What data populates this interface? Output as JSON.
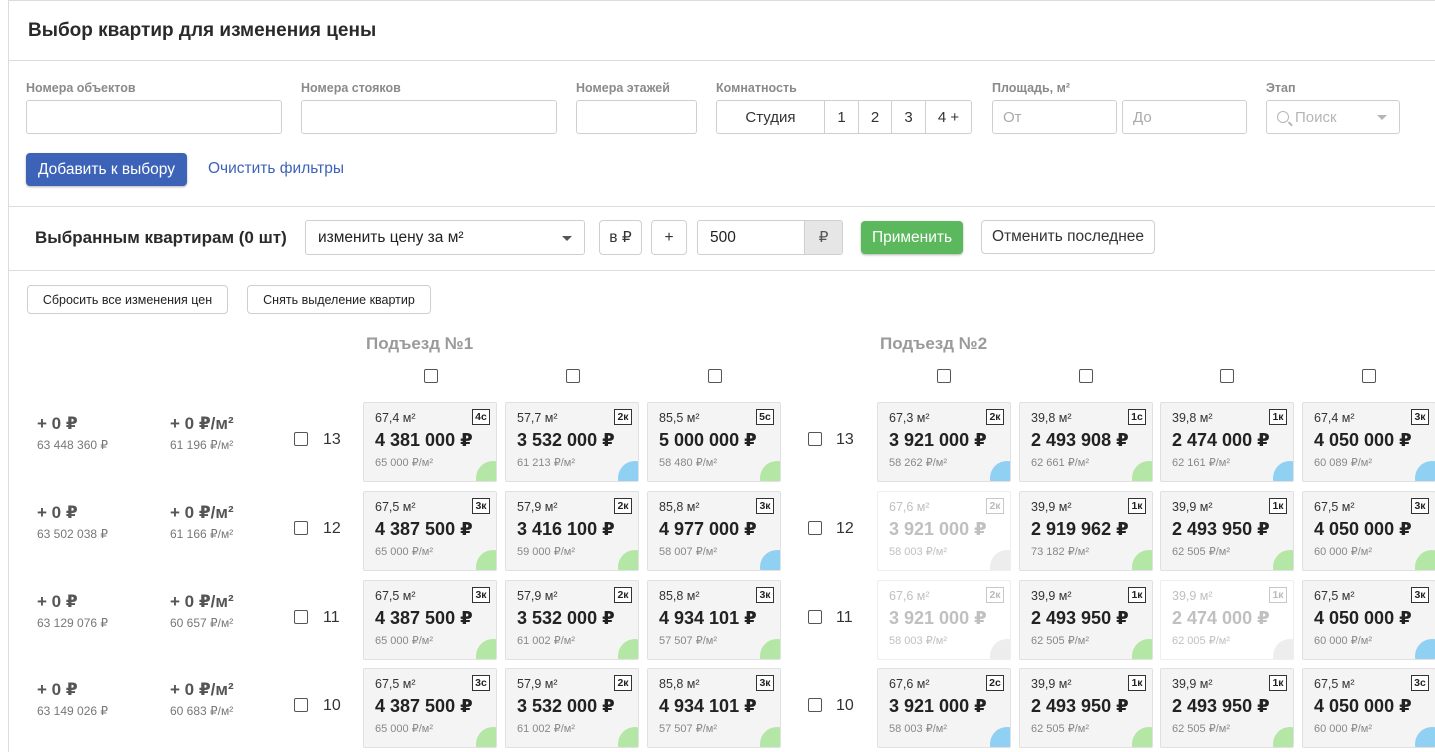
{
  "page_title": "Выбор квартир для изменения цены",
  "filters": {
    "objects_label": "Номера объектов",
    "risers_label": "Номера стояков",
    "floors_label": "Номера этажей",
    "rooms_label": "Комнатность",
    "rooms_options": [
      "Студия",
      "1",
      "2",
      "3",
      "4 +"
    ],
    "area_label": "Площадь, м²",
    "area_from_placeholder": "От",
    "area_to_placeholder": "До",
    "stage_label": "Этап",
    "stage_placeholder": "Поиск",
    "add_button": "Добавить к выбору",
    "clear_link": "Очистить фильтры"
  },
  "action_bar": {
    "selected_label": "Выбранным квартирам (0 шт)",
    "mode_value": "изменить цену за м²",
    "unit_toggle": "в ₽",
    "sign": "+",
    "amount_value": "500",
    "amount_unit": "₽",
    "apply_button": "Применить",
    "undo_button": "Отменить последнее"
  },
  "reset_buttons": {
    "reset_prices": "Сбросить все изменения цен",
    "clear_selection": "Снять выделение квартир"
  },
  "entrances": [
    "Подъезд №1",
    "Подъезд №2"
  ],
  "floors": [
    {
      "floor": "13",
      "delta_total": "+ 0 ₽",
      "total": "63 448 360 ₽",
      "delta_ppm": "+ 0 ₽/м²",
      "avg_ppm": "61 196 ₽/м²",
      "entrance1": [
        {
          "area": "67,4 м²",
          "type": "4с",
          "price": "4 381 000 ₽",
          "ppm": "65 000 ₽/м²",
          "status": "green",
          "dim": false
        },
        {
          "area": "57,7 м²",
          "type": "2к",
          "price": "3 532 000 ₽",
          "ppm": "61 213 ₽/м²",
          "status": "blue",
          "dim": false
        },
        {
          "area": "85,5 м²",
          "type": "5с",
          "price": "5 000 000 ₽",
          "ppm": "58 480 ₽/м²",
          "status": "green",
          "dim": false
        }
      ],
      "entrance2": [
        {
          "area": "67,3 м²",
          "type": "2к",
          "price": "3 921 000 ₽",
          "ppm": "58 262 ₽/м²",
          "status": "blue",
          "dim": false
        },
        {
          "area": "39,8 м²",
          "type": "1с",
          "price": "2 493 908 ₽",
          "ppm": "62 661 ₽/м²",
          "status": "green",
          "dim": false
        },
        {
          "area": "39,8 м²",
          "type": "1к",
          "price": "2 474 000 ₽",
          "ppm": "62 161 ₽/м²",
          "status": "blue",
          "dim": false
        },
        {
          "area": "67,4 м²",
          "type": "3к",
          "price": "4 050 000 ₽",
          "ppm": "60 089 ₽/м²",
          "status": "blue",
          "dim": false
        }
      ]
    },
    {
      "floor": "12",
      "delta_total": "+ 0 ₽",
      "total": "63 502 038 ₽",
      "delta_ppm": "+ 0 ₽/м²",
      "avg_ppm": "61 166 ₽/м²",
      "entrance1": [
        {
          "area": "67,5 м²",
          "type": "3к",
          "price": "4 387 500 ₽",
          "ppm": "65 000 ₽/м²",
          "status": "green",
          "dim": false
        },
        {
          "area": "57,9 м²",
          "type": "2к",
          "price": "3 416 100 ₽",
          "ppm": "59 000 ₽/м²",
          "status": "green",
          "dim": false
        },
        {
          "area": "85,8 м²",
          "type": "3к",
          "price": "4 977 000 ₽",
          "ppm": "58 007 ₽/м²",
          "status": "blue",
          "dim": false
        }
      ],
      "entrance2": [
        {
          "area": "67,6 м²",
          "type": "2к",
          "price": "3 921 000 ₽",
          "ppm": "58 003 ₽/м²",
          "status": "grey",
          "dim": true
        },
        {
          "area": "39,9 м²",
          "type": "1к",
          "price": "2 919 962 ₽",
          "ppm": "73 182 ₽/м²",
          "status": "green",
          "dim": false
        },
        {
          "area": "39,9 м²",
          "type": "1к",
          "price": "2 493 950 ₽",
          "ppm": "62 505 ₽/м²",
          "status": "green",
          "dim": false
        },
        {
          "area": "67,5 м²",
          "type": "3к",
          "price": "4 050 000 ₽",
          "ppm": "60 000 ₽/м²",
          "status": "green",
          "dim": false
        }
      ]
    },
    {
      "floor": "11",
      "delta_total": "+ 0 ₽",
      "total": "63 129 076 ₽",
      "delta_ppm": "+ 0 ₽/м²",
      "avg_ppm": "60 657 ₽/м²",
      "entrance1": [
        {
          "area": "67,5 м²",
          "type": "3к",
          "price": "4 387 500 ₽",
          "ppm": "65 000 ₽/м²",
          "status": "green",
          "dim": false
        },
        {
          "area": "57,9 м²",
          "type": "2к",
          "price": "3 532 000 ₽",
          "ppm": "61 002 ₽/м²",
          "status": "green",
          "dim": false
        },
        {
          "area": "85,8 м²",
          "type": "3к",
          "price": "4 934 101 ₽",
          "ppm": "57 507 ₽/м²",
          "status": "green",
          "dim": false
        }
      ],
      "entrance2": [
        {
          "area": "67,6 м²",
          "type": "2к",
          "price": "3 921 000 ₽",
          "ppm": "58 003 ₽/м²",
          "status": "grey",
          "dim": true
        },
        {
          "area": "39,9 м²",
          "type": "1к",
          "price": "2 493 950 ₽",
          "ppm": "62 505 ₽/м²",
          "status": "green",
          "dim": false
        },
        {
          "area": "39,9 м²",
          "type": "1к",
          "price": "2 474 000 ₽",
          "ppm": "62 005 ₽/м²",
          "status": "grey",
          "dim": true
        },
        {
          "area": "67,5 м²",
          "type": "3к",
          "price": "4 050 000 ₽",
          "ppm": "60 000 ₽/м²",
          "status": "blue",
          "dim": false
        }
      ]
    },
    {
      "floor": "10",
      "delta_total": "+ 0 ₽",
      "total": "63 149 026 ₽",
      "delta_ppm": "+ 0 ₽/м²",
      "avg_ppm": "60 683 ₽/м²",
      "entrance1": [
        {
          "area": "67,5 м²",
          "type": "3с",
          "price": "4 387 500 ₽",
          "ppm": "65 000 ₽/м²",
          "status": "green",
          "dim": false
        },
        {
          "area": "57,9 м²",
          "type": "2к",
          "price": "3 532 000 ₽",
          "ppm": "61 002 ₽/м²",
          "status": "green",
          "dim": false
        },
        {
          "area": "85,8 м²",
          "type": "3к",
          "price": "4 934 101 ₽",
          "ppm": "57 507 ₽/м²",
          "status": "green",
          "dim": false
        }
      ],
      "entrance2": [
        {
          "area": "67,6 м²",
          "type": "2с",
          "price": "3 921 000 ₽",
          "ppm": "58 003 ₽/м²",
          "status": "blue",
          "dim": false
        },
        {
          "area": "39,9 м²",
          "type": "1к",
          "price": "2 493 950 ₽",
          "ppm": "62 505 ₽/м²",
          "status": "green",
          "dim": false
        },
        {
          "area": "39,9 м²",
          "type": "1к",
          "price": "2 493 950 ₽",
          "ppm": "62 505 ₽/м²",
          "status": "green",
          "dim": false
        },
        {
          "area": "67,5 м²",
          "type": "3с",
          "price": "4 050 000 ₽",
          "ppm": "60 000 ₽/м²",
          "status": "blue",
          "dim": false
        }
      ]
    }
  ]
}
